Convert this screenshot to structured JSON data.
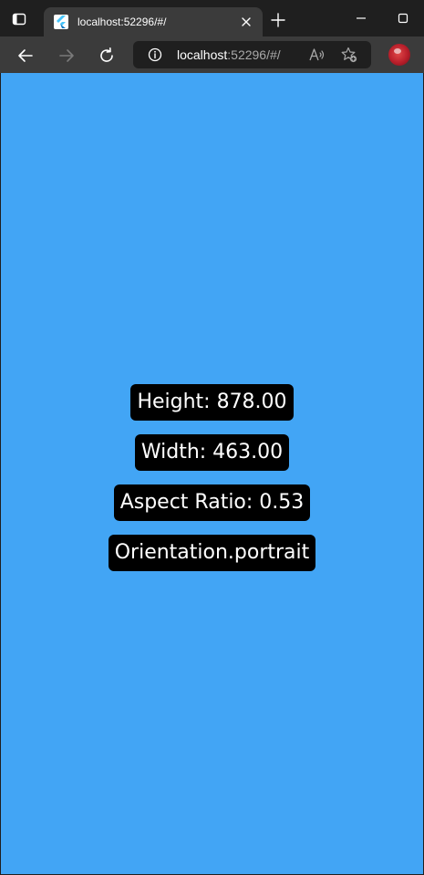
{
  "browser": {
    "tab": {
      "title": "localhost:52296/#/",
      "favicon": "flutter-icon"
    },
    "address": {
      "host": "localhost",
      "rest": ":52296/#/"
    },
    "icons": {
      "tab_actions": "tab-actions-icon",
      "close": "close-icon",
      "new_tab": "plus-icon",
      "minimize": "minimize-icon",
      "maximize": "maximize-icon",
      "back": "back-arrow-icon",
      "forward": "forward-arrow-icon",
      "refresh": "refresh-icon",
      "site_info": "info-icon",
      "read_aloud": "read-aloud-icon",
      "favorites": "favorites-add-icon",
      "profile": "profile-avatar"
    }
  },
  "app": {
    "background_color": "#42a5f5",
    "chip_color": "#000000",
    "height_label": "Height: 878.00",
    "width_label": "Width: 463.00",
    "aspect_ratio_label": "Aspect Ratio: 0.53",
    "orientation_label": "Orientation.portrait"
  }
}
